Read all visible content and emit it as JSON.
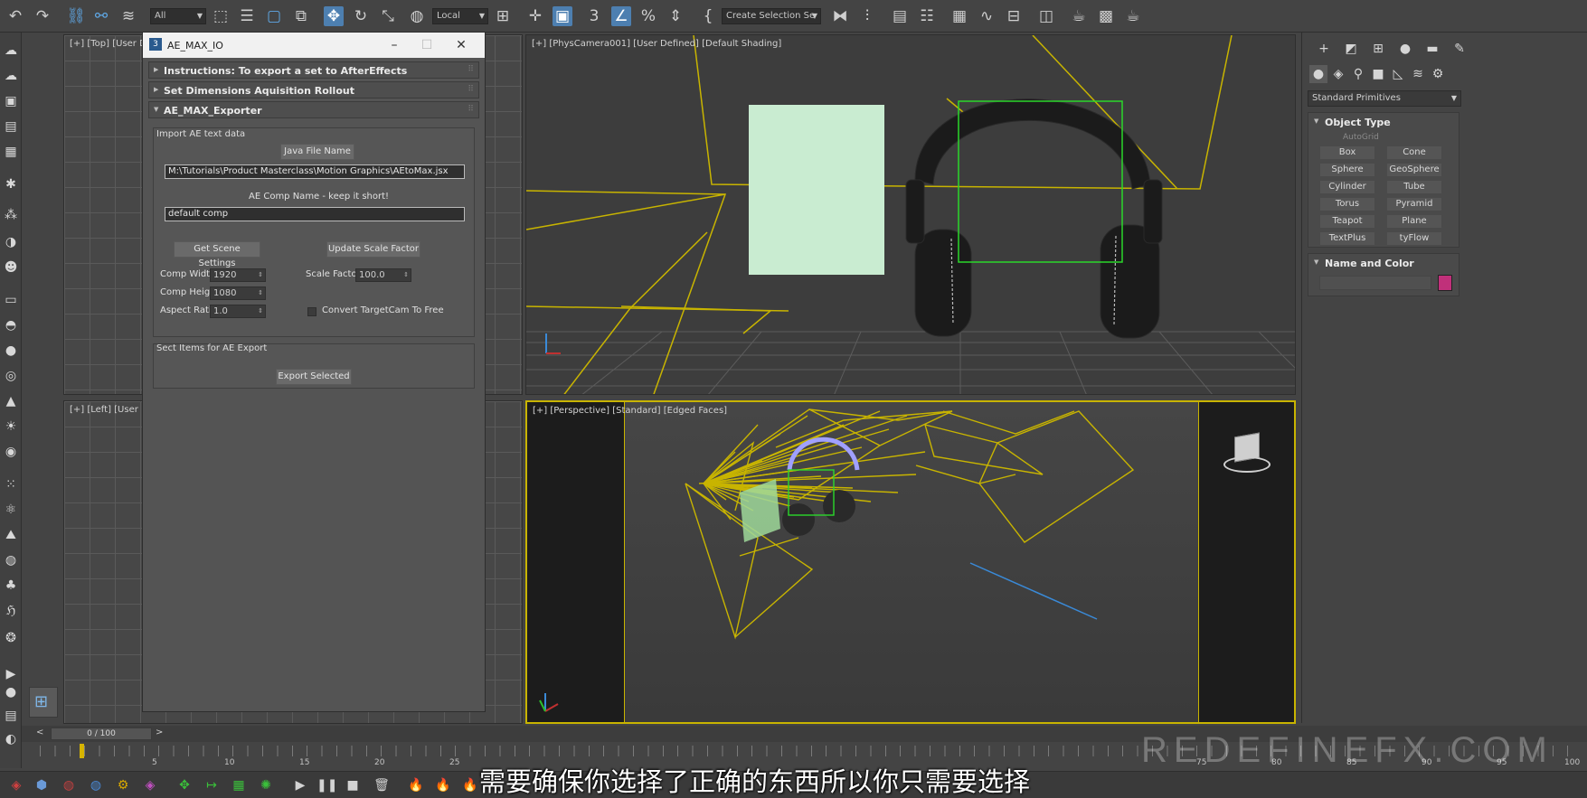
{
  "toolbar": {
    "selection_filter": "All",
    "coord_system": "Local",
    "named_selection_set": "Create Selection Se"
  },
  "viewports": {
    "top": {
      "label": "[+] [Top] [User D"
    },
    "left": {
      "label": "[+] [Left] [User"
    },
    "camera": {
      "label": "[+] [PhysCamera001] [User Defined] [Default Shading]"
    },
    "perspective": {
      "label": "[+] [Perspective] [Standard] [Edged Faces]"
    }
  },
  "dialog": {
    "title": "AE_MAX_IO",
    "app_icon": "3",
    "rollouts": [
      "Instructions: To export a set to AfterEffects",
      "Set Dimensions Aquisition Rollout",
      "AE_MAX_Exporter"
    ],
    "import_group": {
      "title": "Import AE text data",
      "java_button": "Java File Name",
      "java_path": "M:\\Tutorials\\Product Masterclass\\Motion Graphics\\AEtoMax.jsx",
      "comp_name_label": "AE Comp Name - keep it short!",
      "comp_name_value": "default comp",
      "get_scene_button": "Get Scene Settings",
      "update_scale_button": "Update Scale Factor",
      "comp_width_label": "Comp Width",
      "comp_width_value": "1920",
      "comp_height_label": "Comp Height",
      "comp_height_value": "1080",
      "aspect_label": "Aspect Ratio",
      "aspect_value": "1.0",
      "scale_label": "Scale Factor",
      "scale_value": "100.0",
      "convert_label": "Convert TargetCam To Free"
    },
    "export_group": {
      "title": "Sect Items for AE Export",
      "export_button": "Export Selected"
    }
  },
  "command_panel": {
    "dropdown": "Standard Primitives",
    "object_type_title": "Object Type",
    "autogrid": "AutoGrid",
    "primitives": [
      "Box",
      "Cone",
      "Sphere",
      "GeoSphere",
      "Cylinder",
      "Tube",
      "Torus",
      "Pyramid",
      "Teapot",
      "Plane",
      "TextPlus",
      "tyFlow"
    ],
    "name_color_title": "Name and Color",
    "color_swatch": "#c0307a"
  },
  "timeline": {
    "frame_display": "0 / 100",
    "ticks": [
      "5",
      "10",
      "15",
      "20",
      "25",
      "75",
      "80",
      "85",
      "90",
      "95",
      "100"
    ]
  },
  "subtitle": "需要确保你选择了正确的东西所以你只需要选择",
  "watermark": "REDEFINEFX.COM",
  "colors": {
    "wireframe": "#c8b400",
    "selection": "#3ad83a",
    "accent_blue": "#4d7fb0"
  }
}
